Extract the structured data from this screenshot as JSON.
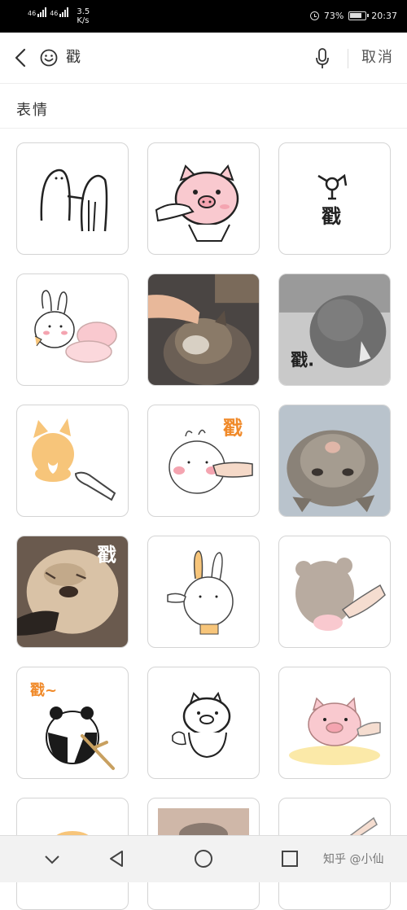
{
  "status_bar": {
    "signal1": "46",
    "signal2": "46",
    "net_speed_value": "3.5",
    "net_speed_unit": "K/s",
    "battery": "73%",
    "time": "20:37"
  },
  "search": {
    "query": "戳",
    "cancel_label": "取消"
  },
  "section": {
    "title": "表情"
  },
  "stickers": [
    {
      "name": "ghost-poke-sticker"
    },
    {
      "name": "pig-poke-face-sticker"
    },
    {
      "name": "stick-figure-poke-sticker",
      "text": "戳"
    },
    {
      "name": "bunny-pig-sticker"
    },
    {
      "name": "cat-head-poke-photo"
    },
    {
      "name": "grey-cat-poke-photo",
      "text": "戳."
    },
    {
      "name": "shiba-back-poke-sticker"
    },
    {
      "name": "round-bunny-poke-sticker",
      "text": "戳"
    },
    {
      "name": "cat-upside-down-photo"
    },
    {
      "name": "dog-chin-poke-photo",
      "text": "戳"
    },
    {
      "name": "white-bunny-poked-sticker"
    },
    {
      "name": "grey-blob-finger-sticker"
    },
    {
      "name": "panda-stick-poke-sticker",
      "text": "戳~"
    },
    {
      "name": "pig-outline-sticker"
    },
    {
      "name": "pink-pig-finger-sticker"
    },
    {
      "name": "partial-sticker-1"
    },
    {
      "name": "partial-sticker-2"
    },
    {
      "name": "partial-sticker-3"
    }
  ],
  "nav": {
    "watermark": "知乎 @小仙"
  },
  "colors": {
    "pig_pink": "#f9c9cf",
    "cheek_pink": "#f4a4b0",
    "shiba_orange": "#f7c57a",
    "poke_text_orange": "#f08a2a",
    "panda_black": "#1a1a1a"
  }
}
